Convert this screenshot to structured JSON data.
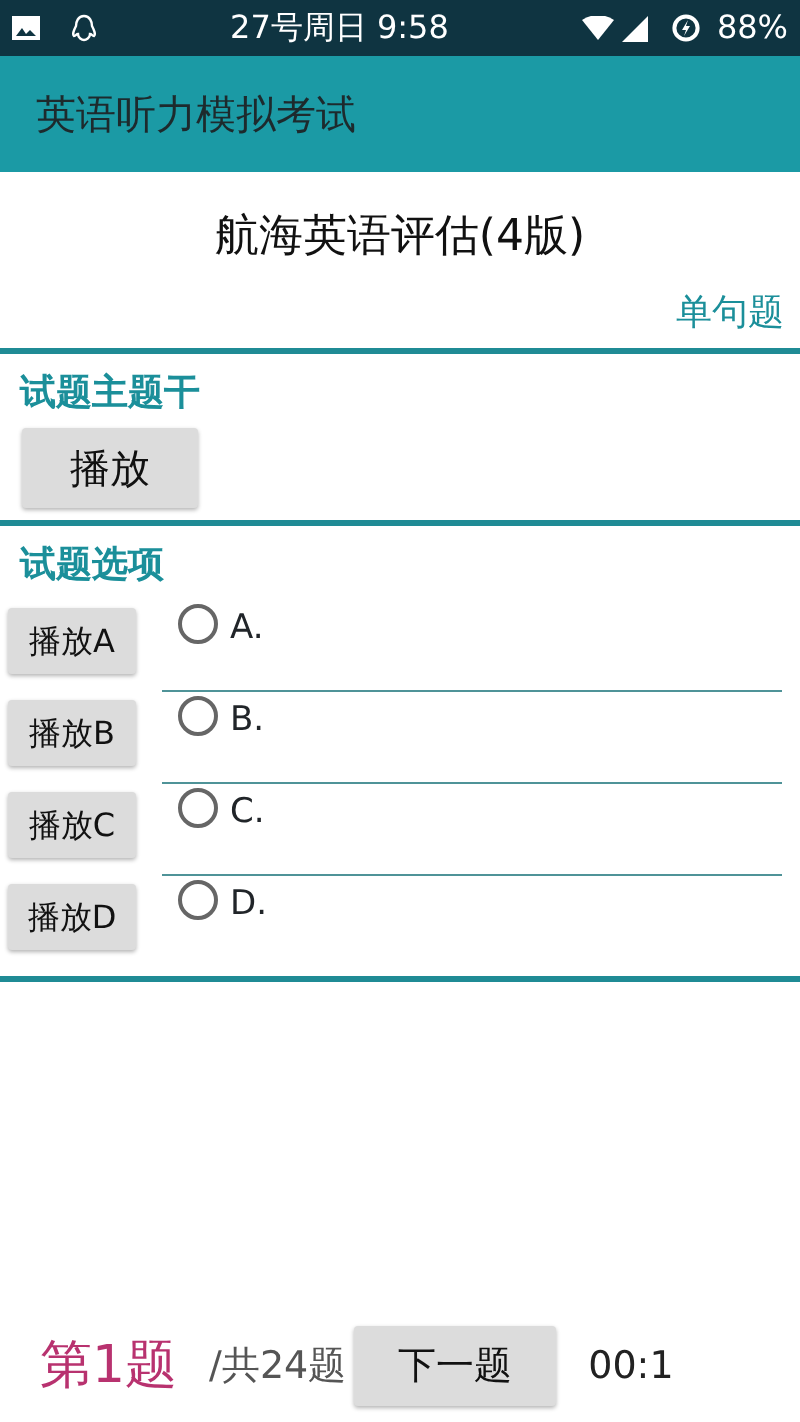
{
  "status_bar": {
    "time": "27号周日 9:58",
    "battery": "88%"
  },
  "app_bar": {
    "title": "英语听力模拟考试"
  },
  "exam_title": "航海英语评估(4版)",
  "question_type": "单句题",
  "stem": {
    "heading": "试题主题干",
    "play_button": "播放"
  },
  "options_section": {
    "heading": "试题选项",
    "options": [
      {
        "play_button": "播放A",
        "label": "A.",
        "selected": false
      },
      {
        "play_button": "播放B",
        "label": "B.",
        "selected": false
      },
      {
        "play_button": "播放C",
        "label": "C.",
        "selected": false
      },
      {
        "play_button": "播放D",
        "label": "D.",
        "selected": false
      }
    ]
  },
  "footer": {
    "current": "第1题",
    "total": "/共24题",
    "next_button": "下一题",
    "timer": "00:1"
  }
}
